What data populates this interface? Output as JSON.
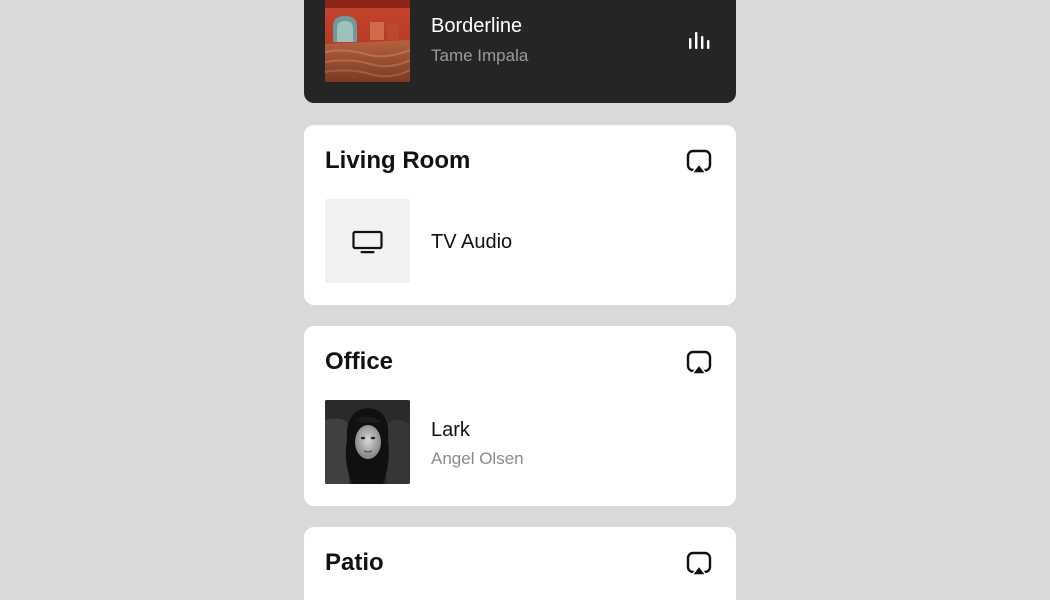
{
  "now_playing": {
    "title": "Borderline",
    "artist": "Tame Impala",
    "art_icon": "album-art-red-desert-room",
    "status_icon": "equalizer-icon"
  },
  "rooms": [
    {
      "name": "Living Room",
      "action_icon": "airplay-icon",
      "source": {
        "icon": "tv-icon",
        "title": "TV Audio",
        "subtitle": ""
      }
    },
    {
      "name": "Office",
      "action_icon": "airplay-icon",
      "source": {
        "icon": "album-art-portrait",
        "title": "Lark",
        "subtitle": "Angel Olsen"
      }
    },
    {
      "name": "Patio",
      "action_icon": "airplay-icon"
    }
  ],
  "colors": {
    "background": "#d9d9d9",
    "card": "#ffffff",
    "now_playing_card": "#252525",
    "secondary_text": "#8a8a8a"
  }
}
